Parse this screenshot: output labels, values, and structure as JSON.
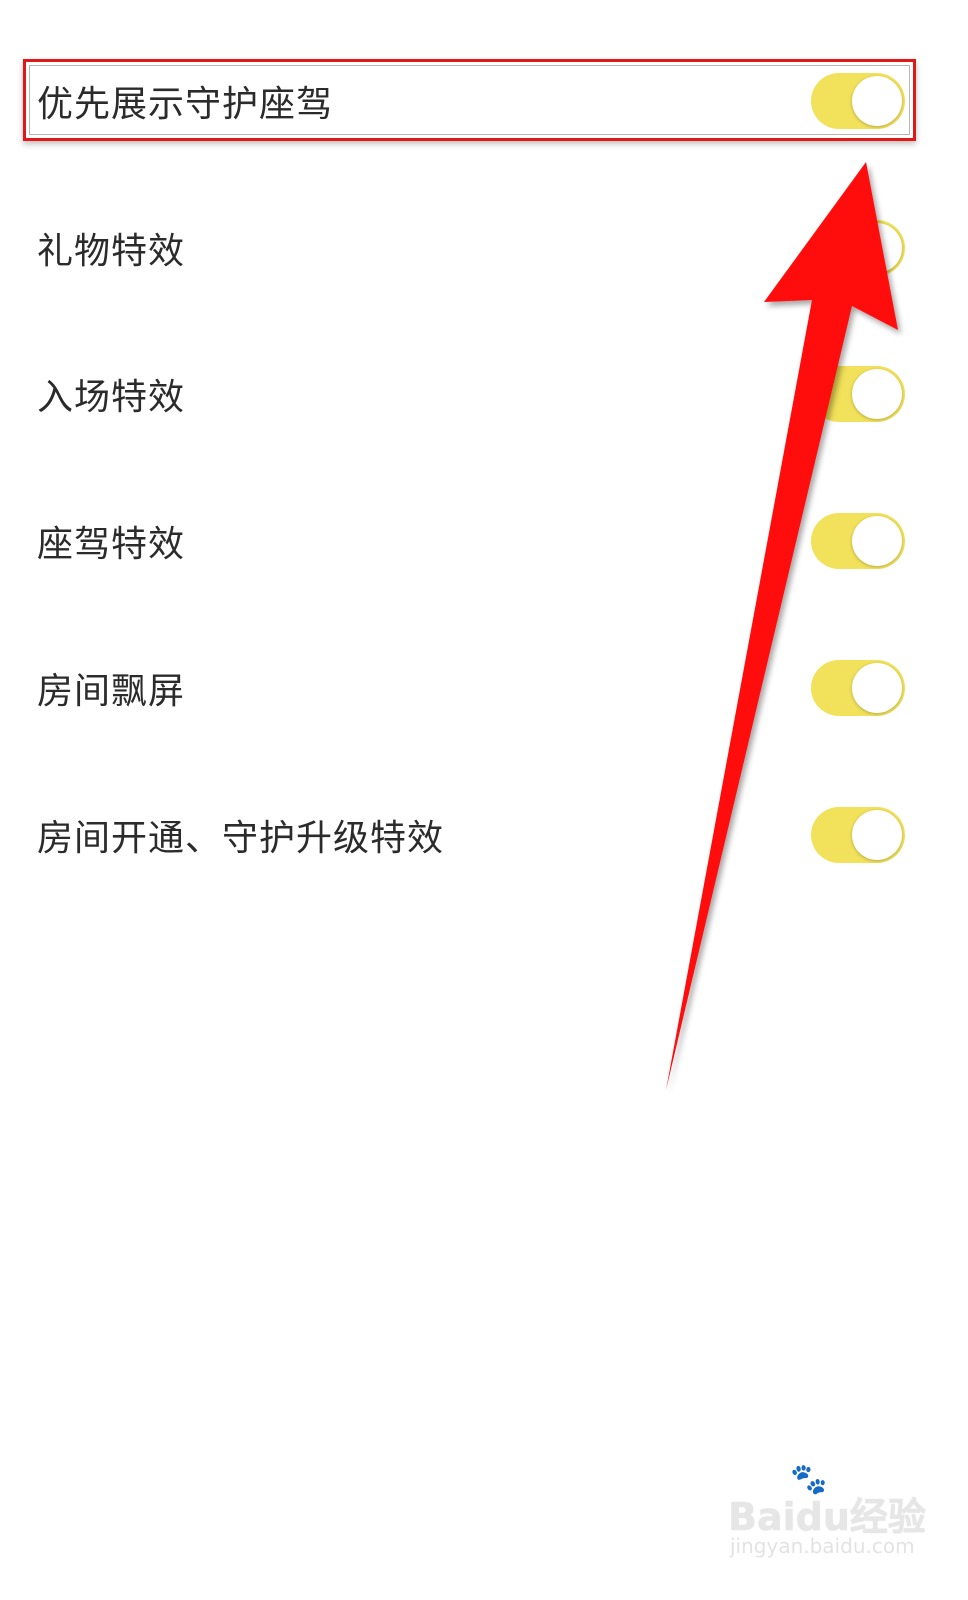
{
  "settings": [
    {
      "label": "优先展示守护座驾",
      "enabled": true
    },
    {
      "label": "礼物特效",
      "enabled": true
    },
    {
      "label": "入场特效",
      "enabled": true
    },
    {
      "label": "座驾特效",
      "enabled": true
    },
    {
      "label": "房间飘屏",
      "enabled": true
    },
    {
      "label": "房间开通、守护升级特效",
      "enabled": true
    }
  ],
  "colors": {
    "toggle_on": "#f2e15a",
    "annotation": "#e11818"
  },
  "watermark": {
    "logo": "Baidu经验",
    "url": "jingyan.baidu.com"
  }
}
